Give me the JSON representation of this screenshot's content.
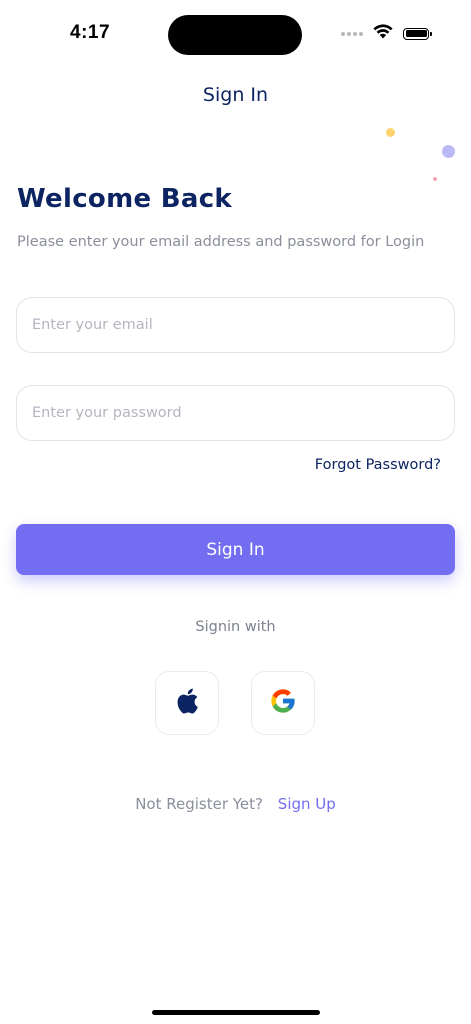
{
  "status_bar": {
    "time": "4:17"
  },
  "header": {
    "title": "Sign In"
  },
  "login": {
    "heading": "Welcome Back",
    "subtitle": "Please enter your email address and password for Login",
    "email": {
      "value": "",
      "placeholder": "Enter your email"
    },
    "password": {
      "value": "",
      "placeholder": "Enter your password"
    },
    "forgot_label": "Forgot Password?",
    "submit_label": "Sign In"
  },
  "social": {
    "label": "Signin with",
    "providers": [
      {
        "icon": "apple-icon"
      },
      {
        "icon": "google-icon"
      }
    ]
  },
  "register": {
    "prompt": "Not Register Yet?",
    "link_label": "Sign Up"
  },
  "colors": {
    "primary": "#736ef1",
    "heading": "#0c2461",
    "muted": "#8b8f9c"
  }
}
